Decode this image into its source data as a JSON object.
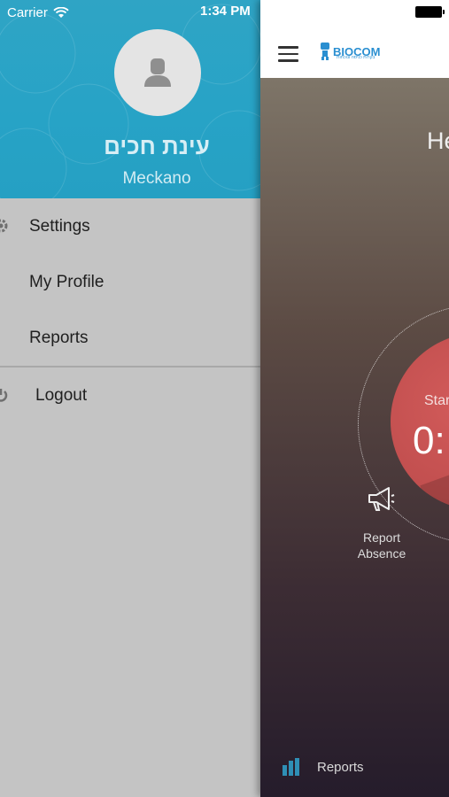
{
  "status_bar": {
    "carrier": "Carrier",
    "time": "1:34 PM"
  },
  "drawer": {
    "user_name": "עינת חכים",
    "company": "Meckano",
    "menu": [
      {
        "label": "Settings",
        "icon": "gear-icon"
      },
      {
        "label": "My Profile"
      },
      {
        "label": "Reports"
      }
    ],
    "logout_label": "Logout"
  },
  "main": {
    "logo_text": "biocom",
    "logo_sub": "בקרות כניסה ונוכחות",
    "greeting": "He",
    "start_label": "Star",
    "timer": "0:",
    "report_absence": "Report\nAbsence",
    "report_absence_l1": "Report",
    "report_absence_l2": "Absence",
    "reports_label": "Reports"
  },
  "colors": {
    "header_blue": "#27a3c6",
    "red_button": "#c24f4f"
  }
}
